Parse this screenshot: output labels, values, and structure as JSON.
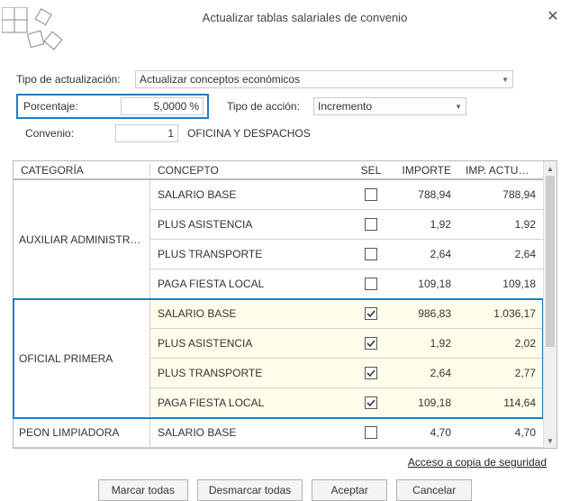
{
  "window": {
    "title": "Actualizar tablas salariales de convenio"
  },
  "form": {
    "tipo_actual_label": "Tipo de actualización:",
    "tipo_actual_value": "Actualizar conceptos económicos",
    "porcentaje_label": "Porcentaje:",
    "porcentaje_value": "5,0000",
    "porcentaje_unit": "%",
    "tipo_accion_label": "Tipo de acción:",
    "tipo_accion_value": "Incremento",
    "convenio_label": "Convenio:",
    "convenio_num": "1",
    "convenio_name": "OFICINA Y DESPACHOS"
  },
  "table": {
    "headers": {
      "categoria": "CATEGORÍA",
      "concepto": "CONCEPTO",
      "sel": "SEL",
      "importe": "IMPORTE",
      "imp_act": "IMP. ACTUALI..."
    },
    "groups": [
      {
        "categoria": "AUXILIAR ADMINISTRATI...",
        "highlighted": false,
        "rows": [
          {
            "concepto": "SALARIO BASE",
            "sel": false,
            "importe": "788,94",
            "imp_act": "788,94"
          },
          {
            "concepto": "PLUS ASISTENCIA",
            "sel": false,
            "importe": "1,92",
            "imp_act": "1,92"
          },
          {
            "concepto": "PLUS TRANSPORTE",
            "sel": false,
            "importe": "2,64",
            "imp_act": "2,64"
          },
          {
            "concepto": "PAGA FIESTA LOCAL",
            "sel": false,
            "importe": "109,18",
            "imp_act": "109,18"
          }
        ]
      },
      {
        "categoria": "OFICIAL PRIMERA",
        "highlighted": true,
        "rows": [
          {
            "concepto": "SALARIO BASE",
            "sel": true,
            "importe": "986,83",
            "imp_act": "1.036,17"
          },
          {
            "concepto": "PLUS ASISTENCIA",
            "sel": true,
            "importe": "1,92",
            "imp_act": "2,02"
          },
          {
            "concepto": "PLUS TRANSPORTE",
            "sel": true,
            "importe": "2,64",
            "imp_act": "2,77"
          },
          {
            "concepto": "PAGA FIESTA LOCAL",
            "sel": true,
            "importe": "109,18",
            "imp_act": "114,64"
          }
        ]
      },
      {
        "categoria": "PEON LIMPIADORA",
        "highlighted": false,
        "rows": [
          {
            "concepto": "SALARIO BASE",
            "sel": false,
            "importe": "4,70",
            "imp_act": "4,70"
          }
        ]
      }
    ]
  },
  "links": {
    "backup": "Acceso a copia de seguridad"
  },
  "buttons": {
    "mark_all": "Marcar todas",
    "unmark_all": "Desmarcar todas",
    "accept": "Aceptar",
    "cancel": "Cancelar"
  }
}
